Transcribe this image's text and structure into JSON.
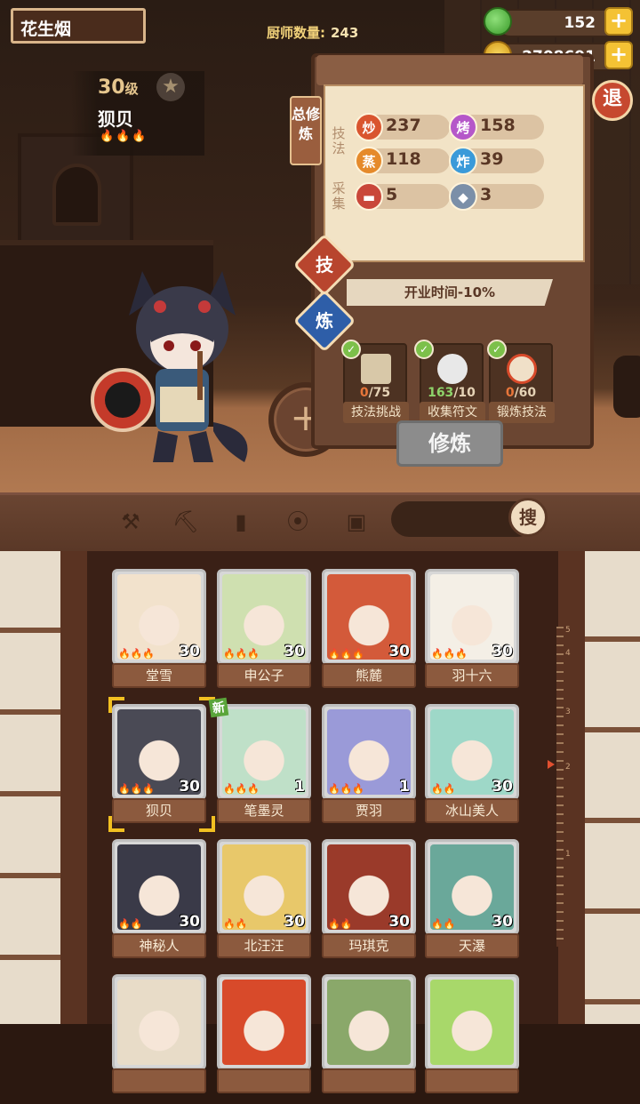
{
  "player": {
    "name": "花生烟"
  },
  "header": {
    "chef_label": "厨师数量:",
    "chef_count": "243"
  },
  "resources": {
    "jade": "152",
    "coins": "2708691"
  },
  "exit_label": "退",
  "character": {
    "level": "30",
    "level_unit": "级",
    "name": "狈贝",
    "flames": "🔥🔥🔥"
  },
  "cultivation": {
    "side_tab": "总修炼",
    "skill_label": "技法",
    "gather_label": "采集",
    "stats": [
      {
        "icon": "炒",
        "value": "237",
        "color": "#d9552f"
      },
      {
        "icon": "烤",
        "value": "158",
        "color": "#b557c9"
      },
      {
        "icon": "蒸",
        "value": "118",
        "color": "#e58a2b"
      },
      {
        "icon": "炸",
        "value": "39",
        "color": "#3a9ad9"
      },
      {
        "icon": "",
        "value": "5",
        "color": "#c9473a"
      },
      {
        "icon": "",
        "value": "3",
        "color": "#7b8fa8"
      }
    ],
    "tab_skill": "技",
    "tab_refine": "炼",
    "bonus": "开业时间-10%",
    "tasks": [
      {
        "progress": "0",
        "total": "/75",
        "label": "技法挑战"
      },
      {
        "progress": "163",
        "total": "/10",
        "label": "收集符文"
      },
      {
        "progress": "0",
        "total": "/60",
        "label": "锻炼技法"
      }
    ],
    "train_button": "修炼"
  },
  "toolbar": {
    "search_label": "搜"
  },
  "ruler_marks": [
    "5",
    "4",
    "3",
    "2",
    "1"
  ],
  "new_tag": "新",
  "chefs": [
    {
      "name": "堂雪",
      "level": "30",
      "flames": "🔥🔥🔥",
      "color": "#f2e2cc"
    },
    {
      "name": "申公子",
      "level": "30",
      "flames": "🔥🔥🔥",
      "color": "#cfe0b0"
    },
    {
      "name": "熊麓",
      "level": "30",
      "flames": "🔥🔥🔥",
      "color": "#d35a3a"
    },
    {
      "name": "羽十六",
      "level": "30",
      "flames": "🔥🔥🔥",
      "color": "#f4efe6"
    },
    {
      "name": "狈贝",
      "level": "30",
      "flames": "🔥🔥🔥",
      "color": "#4a4a55"
    },
    {
      "name": "笔墨灵",
      "level": "1",
      "flames": "🔥🔥🔥",
      "color": "#bfe0c8"
    },
    {
      "name": "贾羽",
      "level": "1",
      "flames": "🔥🔥🔥",
      "color": "#9a9ad8"
    },
    {
      "name": "冰山美人",
      "level": "30",
      "flames": "🔥🔥",
      "color": "#9ed8c8"
    },
    {
      "name": "神秘人",
      "level": "30",
      "flames": "🔥🔥",
      "color": "#3a3a48"
    },
    {
      "name": "北汪汪",
      "level": "30",
      "flames": "🔥🔥",
      "color": "#e8c86a"
    },
    {
      "name": "玛琪克",
      "level": "30",
      "flames": "🔥🔥",
      "color": "#9a3a2a"
    },
    {
      "name": "天瀑",
      "level": "30",
      "flames": "🔥🔥",
      "color": "#6aa89a"
    },
    {
      "name": "",
      "level": "",
      "flames": "",
      "color": "#e8dcc8"
    },
    {
      "name": "",
      "level": "",
      "flames": "",
      "color": "#d84a2a"
    },
    {
      "name": "",
      "level": "",
      "flames": "",
      "color": "#8aa86a"
    },
    {
      "name": "",
      "level": "",
      "flames": "",
      "color": "#a8d86a"
    }
  ]
}
